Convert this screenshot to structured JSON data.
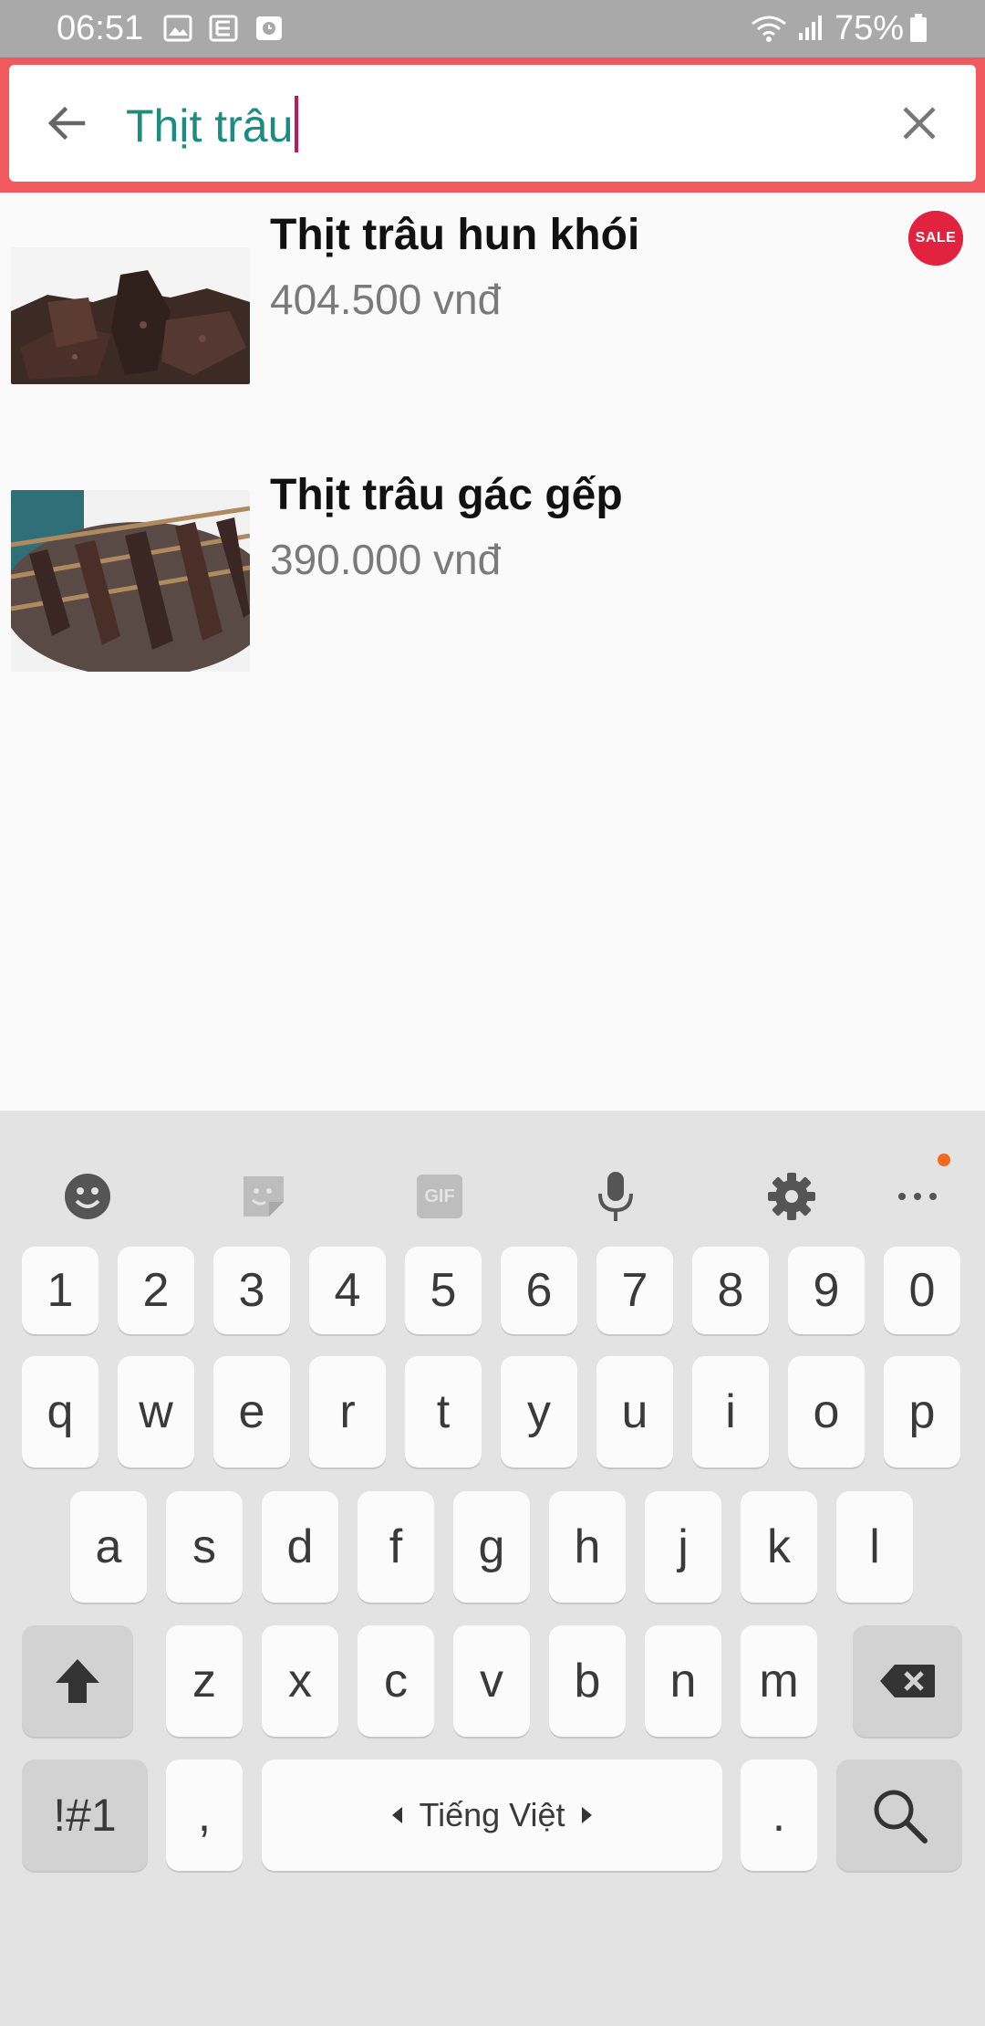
{
  "status_bar": {
    "time": "06:51",
    "battery": "75%",
    "icons": [
      "image-icon",
      "news-icon",
      "clock-app-icon",
      "wifi-icon",
      "signal-icon",
      "battery-icon"
    ]
  },
  "search": {
    "query": "Thịt trâu",
    "back_icon": "arrow-left-icon",
    "clear_icon": "close-icon",
    "accent_color": "#f05a5f",
    "text_color": "#1b8c7f"
  },
  "results": [
    {
      "title": "Thịt trâu hun khói",
      "price": "404.500 vnđ",
      "badge": "SALE"
    },
    {
      "title": "Thịt trâu gác gếp",
      "price": "390.000 vnđ"
    }
  ],
  "keyboard": {
    "toolbar": [
      "emoji-icon",
      "sticker-icon",
      "gif-icon",
      "microphone-icon",
      "settings-icon",
      "more-icon"
    ],
    "gif_label": "GIF",
    "row_numbers": [
      "1",
      "2",
      "3",
      "4",
      "5",
      "6",
      "7",
      "8",
      "9",
      "0"
    ],
    "row_1": [
      "q",
      "w",
      "e",
      "r",
      "t",
      "y",
      "u",
      "i",
      "o",
      "p"
    ],
    "row_2": [
      "a",
      "s",
      "d",
      "f",
      "g",
      "h",
      "j",
      "k",
      "l"
    ],
    "row_3": [
      "z",
      "x",
      "c",
      "v",
      "b",
      "n",
      "m"
    ],
    "symbols_label": "!#1",
    "comma": ",",
    "space_label": "Tiếng Việt",
    "period": "."
  }
}
